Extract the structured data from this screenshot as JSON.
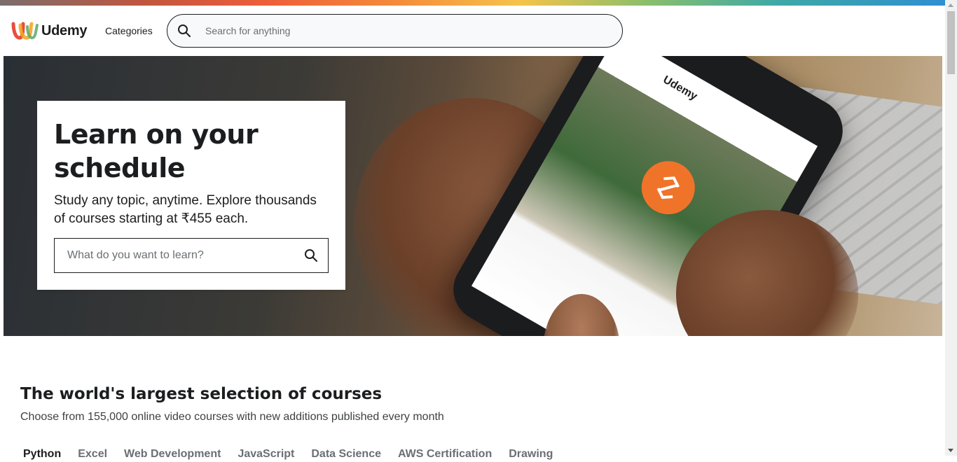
{
  "header": {
    "brand": "Udemy",
    "categories_label": "Categories",
    "search_placeholder": "Search for anything",
    "search_icon": "search-icon"
  },
  "hero": {
    "title": "Learn on your schedule",
    "subtitle": "Study any topic, anytime. Explore thousands of courses starting at ₹455 each.",
    "search_placeholder": "What do you want to learn?",
    "search_icon": "search-icon"
  },
  "section": {
    "title": "The world's largest selection of courses",
    "subtitle": "Choose from 155,000 online video courses with new additions published every month",
    "tabs": [
      {
        "label": "Python"
      },
      {
        "label": "Excel"
      },
      {
        "label": "Web Development"
      },
      {
        "label": "JavaScript"
      },
      {
        "label": "Data Science"
      },
      {
        "label": "AWS Certification"
      },
      {
        "label": "Drawing"
      }
    ],
    "active_tab": "Python"
  },
  "colors": {
    "text": "#1c1d1f",
    "muted": "#6a6f73",
    "accent_orange": "#f0732a"
  }
}
